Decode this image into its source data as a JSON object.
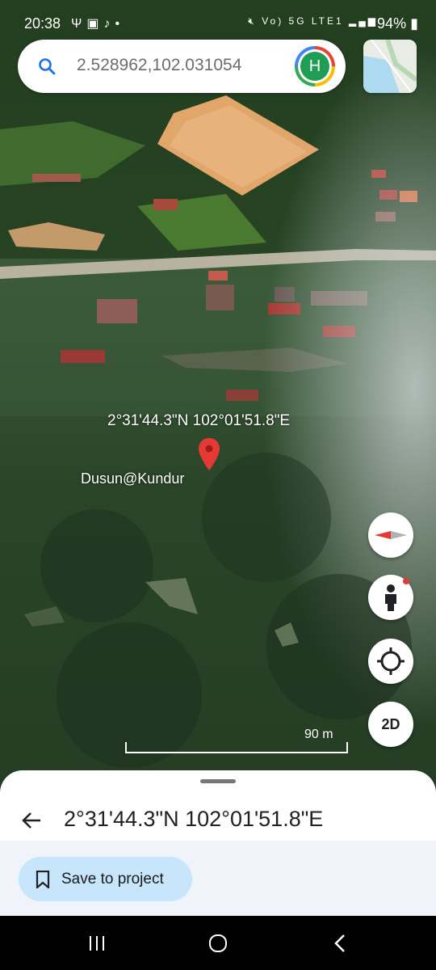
{
  "status_bar": {
    "time": "20:38",
    "left_icons": [
      "usb-icon",
      "gallery-icon",
      "tiktok-icon",
      "dot-icon"
    ],
    "right_icons_text": "Vo) 5G LTE1",
    "battery": "94%"
  },
  "search": {
    "query": "2.528962,102.031054",
    "avatar_initial": "H"
  },
  "map": {
    "pin_coordinates": "2°31'44.3\"N 102°01'51.8\"E",
    "place_label": "Dusun@Kundur",
    "scale_label": "90 m",
    "view_mode_button": "2D"
  },
  "bottom_sheet": {
    "title": "2°31'44.3\"N 102°01'51.8\"E",
    "save_button": "Save to project"
  },
  "colors": {
    "accent": "#1a73e8",
    "pin_red": "#e53935",
    "save_button_bg": "#c8e6fb",
    "avatar_green": "#1f9d55"
  }
}
